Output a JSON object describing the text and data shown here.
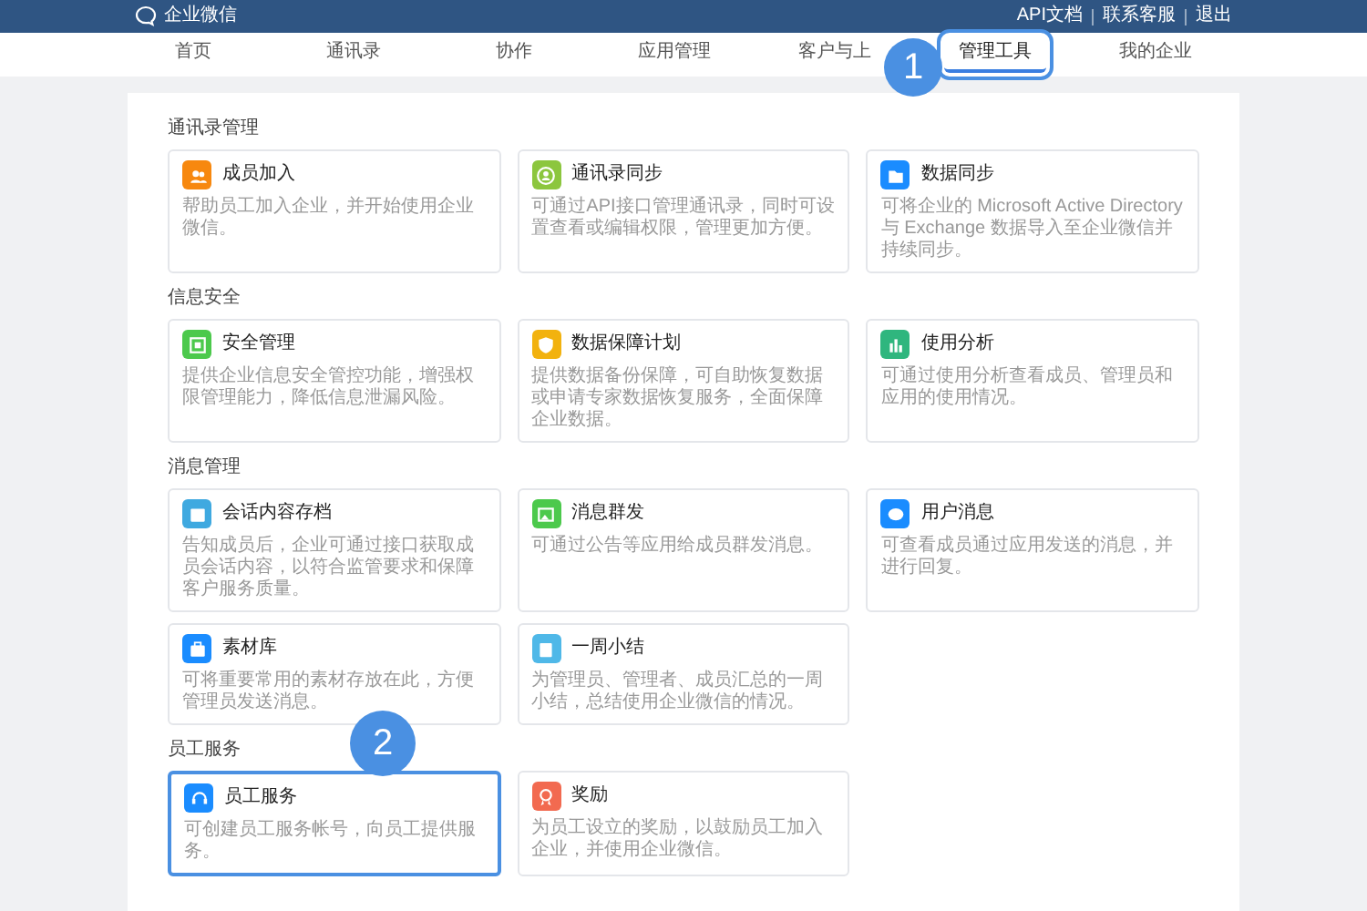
{
  "header": {
    "logo_text": "企业微信",
    "links": [
      "API文档",
      "联系客服",
      "退出"
    ]
  },
  "tabs": [
    {
      "label": "首页",
      "selected": false
    },
    {
      "label": "通讯录",
      "selected": false
    },
    {
      "label": "协作",
      "selected": false
    },
    {
      "label": "应用管理",
      "selected": false
    },
    {
      "label": "客户与上",
      "selected": false
    },
    {
      "label": "管理工具",
      "selected": true,
      "highlighted": true,
      "callout": "1"
    },
    {
      "label": "我的企业",
      "selected": false
    }
  ],
  "sections": [
    {
      "title": "通讯录管理",
      "cards": [
        {
          "title": "成员加入",
          "description": "帮助员工加入企业，并开始使用企业微信。",
          "kind": "people",
          "color": "#f7880f"
        },
        {
          "title": "通讯录同步",
          "description": "可通过API接口管理通讯录，同时可设置查看或编辑权限，管理更加方便。",
          "kind": "person",
          "color": "#8cc63e"
        },
        {
          "title": "数据同步",
          "description": "可将企业的 Microsoft Active Directory 与 Exchange 数据导入至企业微信并持续同步。",
          "kind": "folder",
          "color": "#1a8cff"
        }
      ]
    },
    {
      "title": "信息安全",
      "cards": [
        {
          "title": "安全管理",
          "description": "提供企业信息安全管控功能，增强权限管理能力，降低信息泄漏风险。",
          "kind": "safe",
          "color": "#4cc94c"
        },
        {
          "title": "数据保障计划",
          "description": "提供数据备份保障，可自助恢复数据或申请专家数据恢复服务，全面保障企业数据。",
          "kind": "shield",
          "color": "#f2b20f"
        },
        {
          "title": "使用分析",
          "description": "可通过使用分析查看成员、管理员和应用的使用情况。",
          "kind": "chart",
          "color": "#2fb67e"
        }
      ]
    },
    {
      "title": "消息管理",
      "cards": [
        {
          "title": "会话内容存档",
          "description": "告知成员后，企业可通过接口获取成员会话内容，以符合监管要求和保障客户服务质量。",
          "kind": "archive",
          "color": "#3fa9e0"
        },
        {
          "title": "消息群发",
          "description": "可通过公告等应用给成员群发消息。",
          "kind": "photo",
          "color": "#4cc94c"
        },
        {
          "title": "用户消息",
          "description": "可查看成员通过应用发送的消息，并进行回复。",
          "kind": "bubble",
          "color": "#1a8cff"
        },
        {
          "title": "素材库",
          "description": "可将重要常用的素材存放在此，方便管理员发送消息。",
          "kind": "briefcase",
          "color": "#1a8cff"
        },
        {
          "title": "一周小结",
          "description": "为管理员、管理者、成员汇总的一周小结，总结使用企业微信的情况。",
          "kind": "clipboard",
          "color": "#4fb8e8"
        }
      ]
    },
    {
      "title": "员工服务",
      "cards": [
        {
          "title": "员工服务",
          "description": "可创建员工服务帐号，向员工提供服务。",
          "kind": "headset",
          "color": "#1a8cff",
          "highlighted": true,
          "callout": "2"
        },
        {
          "title": "奖励",
          "description": "为员工设立的奖励，以鼓励员工加入企业，并使用企业微信。",
          "kind": "medal",
          "color": "#f26a50"
        }
      ]
    }
  ]
}
